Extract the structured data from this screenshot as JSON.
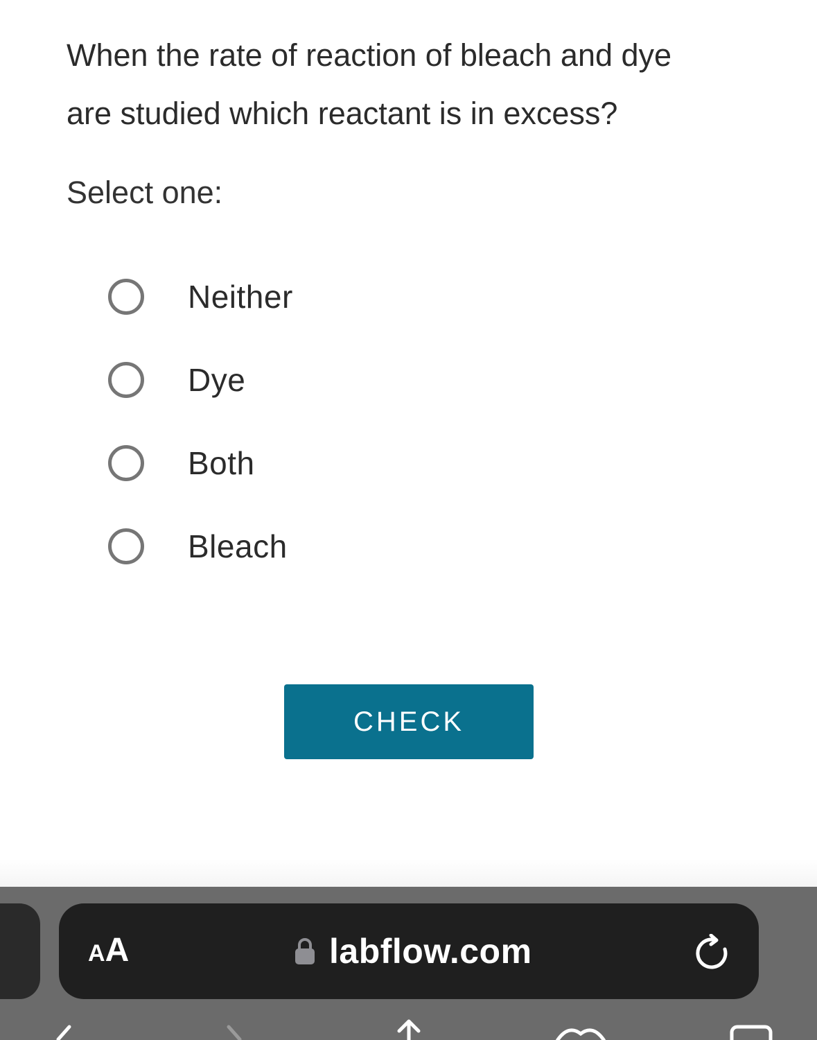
{
  "question": {
    "line1": "When the rate of reaction of bleach and dye",
    "line2": "are studied which reactant is in excess?"
  },
  "prompt": "Select one:",
  "options": [
    {
      "label": "Neither",
      "selected": false
    },
    {
      "label": "Dye",
      "selected": false
    },
    {
      "label": "Both",
      "selected": false
    },
    {
      "label": "Bleach",
      "selected": false
    }
  ],
  "check_button": {
    "label": "CHECK"
  },
  "browser": {
    "text_size_small": "A",
    "text_size_large": "A",
    "url": "labflow.com",
    "lock_icon": "lock-icon",
    "reload_icon": "reload-icon"
  },
  "colors": {
    "accent": "#0a718e",
    "toolbar": "#6b6b6b",
    "address_bar": "#1f1f1f",
    "radio_border": "#767676",
    "text": "#2b2b2b"
  }
}
